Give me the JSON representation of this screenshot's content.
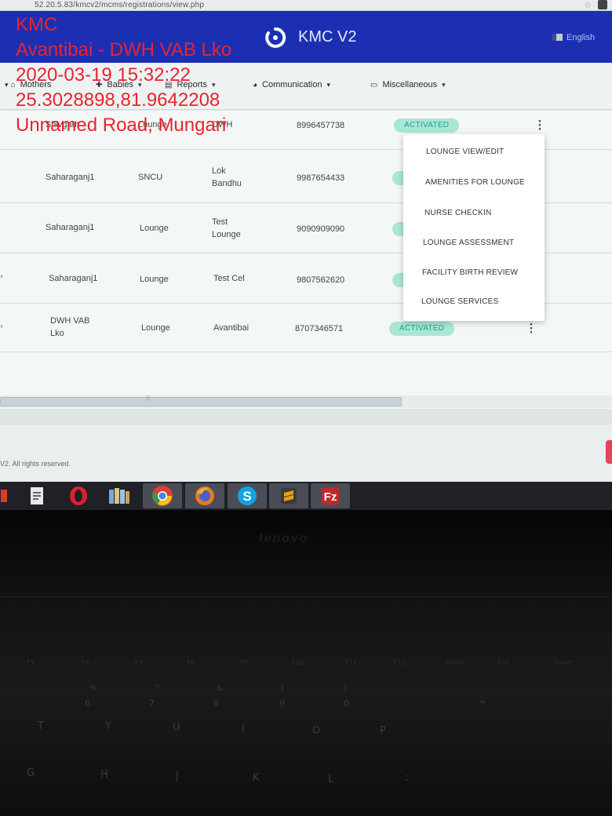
{
  "browser": {
    "url": "52.20.5.83/kmcv2/mcms/registrations/view.php"
  },
  "app": {
    "title": "KMC V2",
    "language": "English"
  },
  "nav": {
    "items": [
      {
        "label": "Mothers",
        "icon": "home-icon"
      },
      {
        "label": "Babies",
        "icon": "baby-icon"
      },
      {
        "label": "Reports",
        "icon": "report-icon"
      },
      {
        "label": "Communication",
        "icon": "globe-icon"
      },
      {
        "label": "Miscellaneous",
        "icon": "folder-icon"
      }
    ]
  },
  "table": {
    "rows": [
      {
        "district": "Shivgarh",
        "type": "Lounge",
        "facility": "DWH",
        "phone": "8996457738",
        "status": "ACTIVATED"
      },
      {
        "district": "Saharaganj1",
        "type": "SNCU",
        "facility": "Lok\nBandhu",
        "phone": "9987654433",
        "status": ""
      },
      {
        "district": "Saharaganj1",
        "type": "Lounge",
        "facility": "Test\nLounge",
        "phone": "9090909090",
        "status": ""
      },
      {
        "district": "Saharaganj1",
        "type": "Lounge",
        "facility": "Test Cel",
        "phone": "9807562620",
        "status": ""
      },
      {
        "district": "DWH VAB\nLko",
        "type": "Lounge",
        "facility": "Avantibai",
        "phone": "8707346571",
        "status": "ACTIVATED"
      }
    ]
  },
  "menu": {
    "items": [
      "LOUNGE VIEW/EDIT",
      "AMENITIES FOR LOUNGE",
      "NURSE CHECKIN",
      "LOUNGE ASSESSMENT",
      "FACILITY BIRTH REVIEW",
      "LOUNGE SERVICES"
    ]
  },
  "footer": {
    "copyright": "V2. All rights reserved."
  },
  "taskbar": {
    "apps": [
      "file-explorer-icon",
      "document-icon",
      "opera-icon",
      "library-icon",
      "chrome-icon",
      "firefox-icon",
      "skype-icon",
      "sublime-icon",
      "filezilla-icon"
    ]
  },
  "keyboard": {
    "fn_keys": [
      "F5",
      "F6",
      "F7",
      "F8",
      "F9",
      "F10",
      "F11",
      "F12",
      "Home",
      "End",
      "Insert"
    ],
    "number_keys": [
      "%",
      "^",
      "&",
      "*",
      "(",
      ")",
      "_",
      "+"
    ],
    "digit_keys": [
      "5",
      "6",
      "7",
      "8",
      "9",
      "0",
      "-",
      "="
    ],
    "letter_keys_row1": [
      "T",
      "Y",
      "U",
      "I",
      "O",
      "P",
      "[",
      "]"
    ],
    "letter_keys_row2": [
      "G",
      "H",
      "J",
      "K",
      "L",
      ":",
      "\""
    ]
  },
  "overlay": {
    "lines": [
      "KMC",
      "Avantibai - DWH VAB Lko",
      "2020-03-19 15:32:22",
      "25.3028898,81.9642208",
      "Unnamed Road, Mungari"
    ]
  },
  "colors": {
    "header": "#1c2fb3",
    "status_bg": "#a9e6d5",
    "status_text": "#1fa48a",
    "overlay": "#e8242f"
  }
}
